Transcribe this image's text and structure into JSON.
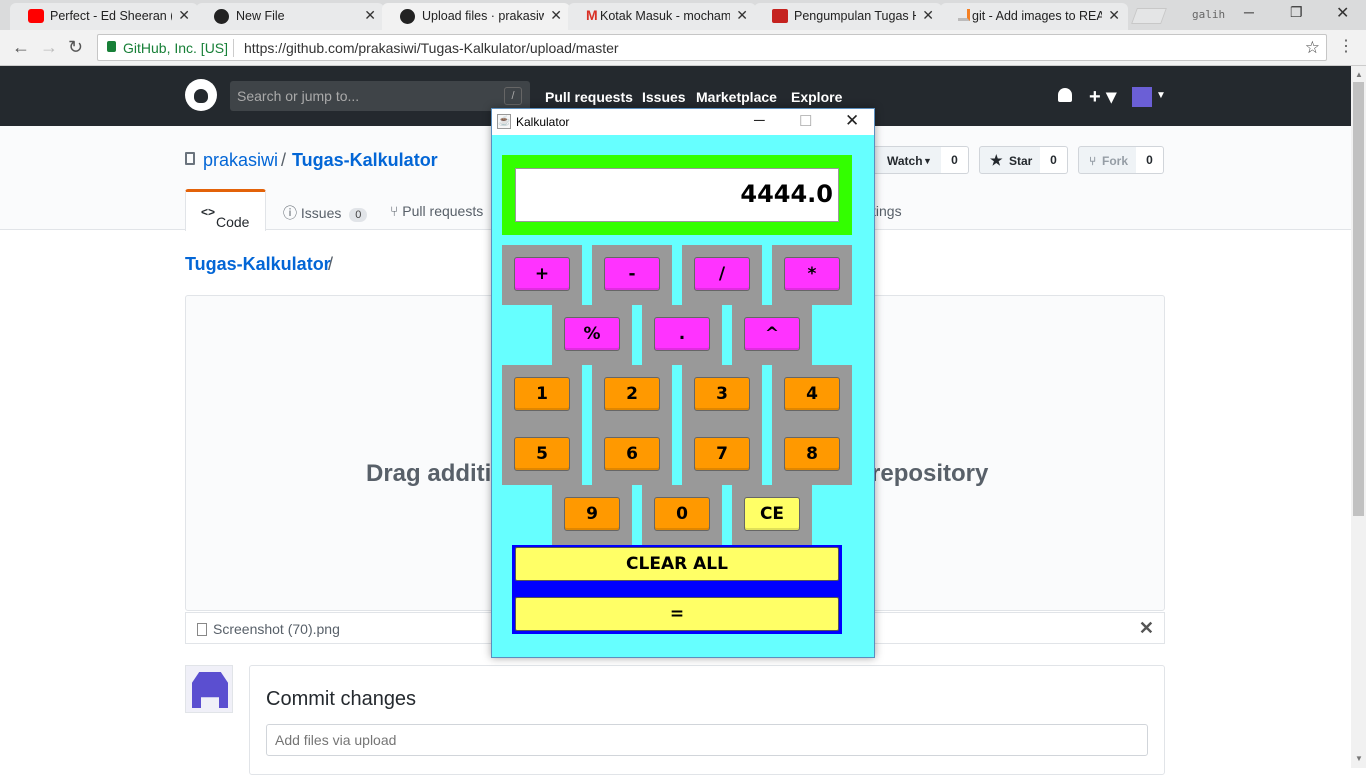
{
  "browser": {
    "tabs": [
      {
        "label": "Perfect - Ed Sheeran (Ly",
        "icon": "youtube-icon"
      },
      {
        "label": "New File",
        "icon": "github-icon"
      },
      {
        "label": "Upload files · prakasiwi/",
        "icon": "github-icon",
        "active": true
      },
      {
        "label": "Kotak Masuk - mocham",
        "icon": "gmail-icon"
      },
      {
        "label": "Pengumpulan Tugas Ha",
        "icon": "classroom-icon"
      },
      {
        "label": "git - Add images to REA",
        "icon": "stackoverflow-icon"
      }
    ],
    "profile": "galih",
    "secure_label": "GitHub, Inc. [US]",
    "url": "https://github.com/prakasiwi/Tugas-Kalkulator/upload/master"
  },
  "github": {
    "search_placeholder": "Search or jump to...",
    "search_key": "/",
    "nav": [
      "Pull requests",
      "Issues",
      "Marketplace",
      "Explore"
    ],
    "repo_owner": "prakasiwi",
    "repo_sep": "/",
    "repo_name": "Tugas-Kalkulator",
    "watch_label": "Watch",
    "watch_count": "0",
    "star_label": "Star",
    "star_count": "0",
    "fork_label": "Fork",
    "fork_count": "0",
    "tabs": {
      "code": "Code",
      "issues": "Issues",
      "issues_count": "0",
      "pull_requests": "Pull requests",
      "settings_tail": "tings"
    },
    "breadcrumb": "Tugas-Kalkulator",
    "breadcrumb_sep": "/",
    "drop_text_left": "Drag additio",
    "drop_text_right": "repository",
    "file_name": "Screenshot (70).png",
    "commit_title": "Commit changes",
    "commit_placeholder": "Add files via upload"
  },
  "calculator": {
    "title": "Kalkulator",
    "display": "4444.0",
    "operators_row1": [
      "+",
      "-",
      "/",
      "*"
    ],
    "operators_row2": [
      "%",
      ".",
      "^"
    ],
    "digits_row1": [
      "1",
      "2",
      "3",
      "4"
    ],
    "digits_row2": [
      "5",
      "6",
      "7",
      "8"
    ],
    "row5": [
      "9",
      "0",
      "CE"
    ],
    "clear_all": "CLEAR ALL",
    "equals": "=",
    "colors": {
      "background": "#66ffff",
      "display_frame": "#33ff00",
      "operator": "#ff33ff",
      "digit": "#ff9900",
      "special": "#ffff66",
      "panel": "#0000ff",
      "grid": "#999999"
    }
  }
}
